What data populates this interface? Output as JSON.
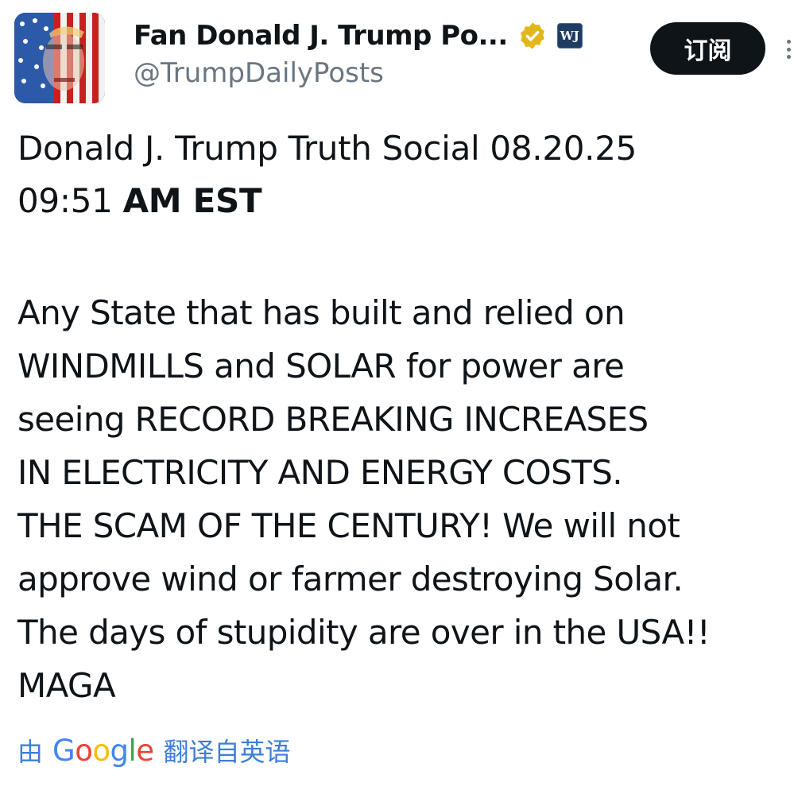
{
  "author": {
    "display_name": "Fan Donald J. Trump Po...",
    "handle": "@TrumpDailyPosts",
    "affiliate_badge": "WJ"
  },
  "actions": {
    "subscribe_label": "订阅"
  },
  "post": {
    "title_normal": "Donald J. Trump Truth Social 08.20.25",
    "time_normal": "09:51 ",
    "time_bold": "AM EST",
    "lines": [
      "Any State that has built and relied on",
      "WINDMILLS and SOLAR for power are",
      "seeing RECORD BREAKING INCREASES",
      "IN ELECTRICITY AND ENERGY COSTS.",
      "THE SCAM OF THE CENTURY! We will not",
      "approve wind or farmer destroying Solar.",
      "The days of stupidity are over in the USA!!",
      "MAGA"
    ]
  },
  "translation": {
    "prefix": "由",
    "provider": "Google",
    "link": "翻译自英语"
  },
  "colors": {
    "text": "#0f1419",
    "secondary": "#6b7680",
    "link": "#3d7fd6",
    "verified": "#e2b719"
  },
  "icons": {
    "verified": "verified-badge-icon",
    "more": "more-options-icon"
  }
}
